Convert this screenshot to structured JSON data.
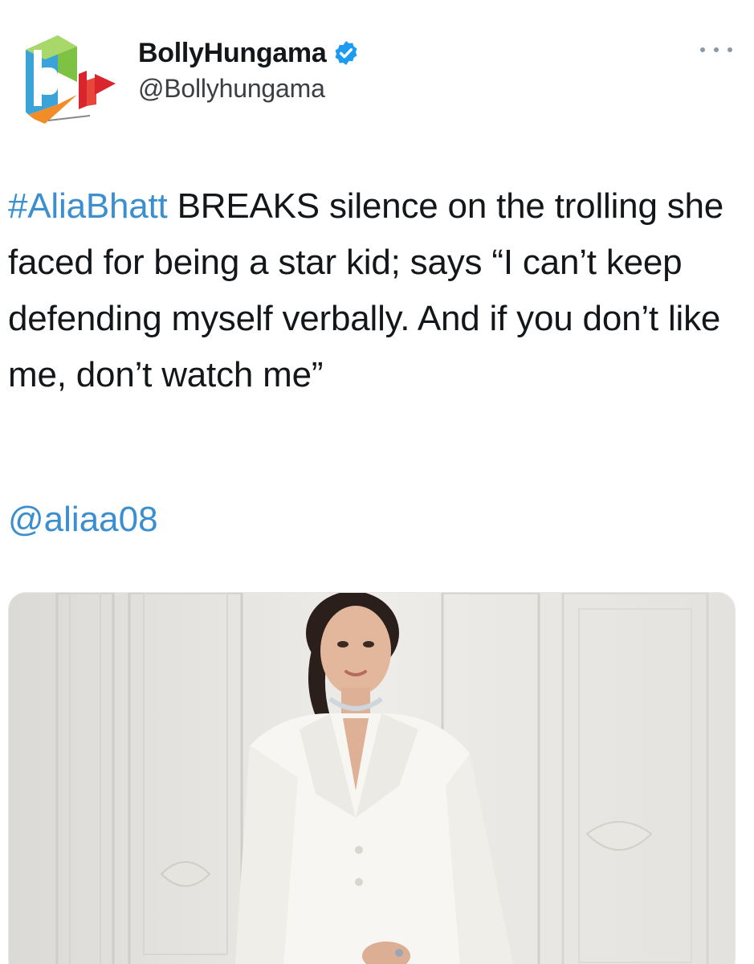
{
  "tweet": {
    "author": {
      "display_name": "BollyHungama",
      "handle": "@Bollyhungama",
      "verified": true,
      "avatar_icon": "bollyhungama-logo-icon"
    },
    "text": {
      "hashtag": "#AliaBhatt",
      "body": " BREAKS silence on the trolling she faced for being a star kid; says “I can’t keep defending myself verbally. And if you don’t like me, don’t watch me”"
    },
    "mention": "@aliaa08",
    "media": {
      "kind": "photo",
      "icon": "photo-woman-white-suit-icon"
    },
    "menu_icon": "more-options-icon"
  },
  "colors": {
    "link": "#3b8fce",
    "verified_badge": "#1d9bf0",
    "text": "#14171a",
    "secondary_text": "#3b3f44"
  }
}
